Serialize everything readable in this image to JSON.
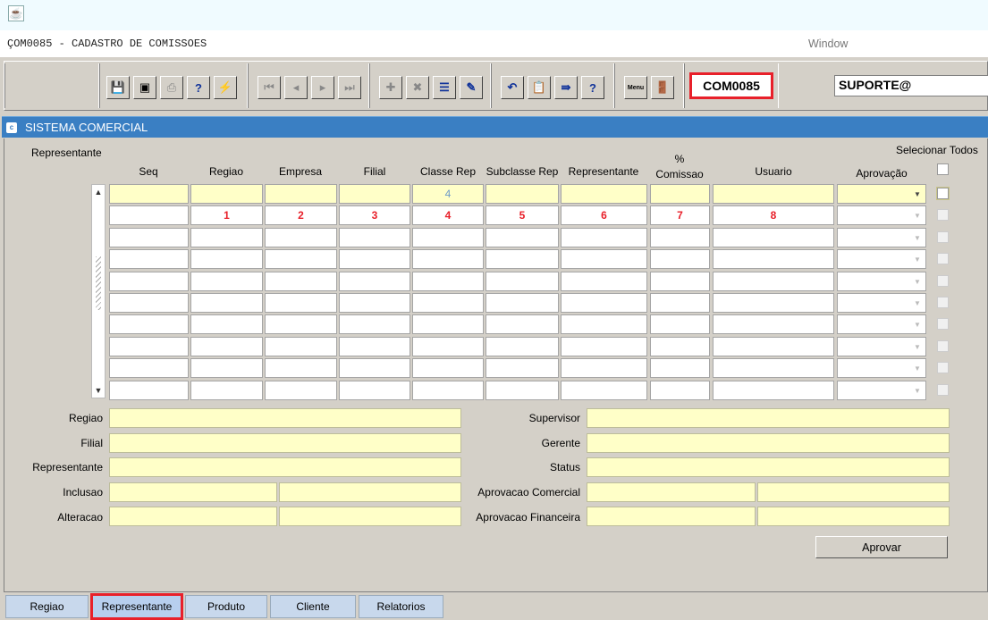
{
  "window": {
    "app_icon": "java-cup-icon",
    "title": "ÇOM0085 - CADASTRO DE COMISSOES",
    "menu_window": "Window"
  },
  "toolbar": {
    "icons": {
      "save": "save-icon",
      "print_screen": "screen-icon",
      "print": "printer-icon",
      "query": "query-icon",
      "execute_query": "execute-query-icon",
      "first": "first-record-icon",
      "prev": "prev-record-icon",
      "next": "next-record-icon",
      "last": "last-record-icon",
      "insert": "insert-record-icon",
      "delete": "delete-record-icon",
      "list": "list-values-icon",
      "edit": "edit-icon",
      "undo": "undo-icon",
      "clipboard": "clipboard-icon",
      "exit_form": "exit-form-icon",
      "help": "help-icon",
      "menu": "menu-icon",
      "exit": "exit-door-icon"
    },
    "help_glyph": "?",
    "menu_glyph": "Menu",
    "form_code": "COM0085",
    "user": "SUPORTE@"
  },
  "panel": {
    "title": "SISTEMA COMERCIAL"
  },
  "grid": {
    "section_label": "Representante",
    "select_all_label": "Selecionar Todos",
    "columns": {
      "seq": "Seq",
      "regiao": "Regiao",
      "empresa": "Empresa",
      "filial": "Filial",
      "classe_rep": "Classe Rep",
      "subclasse_rep": "Subclasse Rep",
      "representante": "Representante",
      "pct": "%",
      "comissao": "Comissao",
      "usuario": "Usuario",
      "aprovacao": "Aprovação"
    },
    "row1_classe_rep": "4",
    "row2_markers": {
      "regiao": "1",
      "empresa": "2",
      "filial": "3",
      "classe_rep": "4",
      "subclasse_rep": "5",
      "representante": "6",
      "comissao": "7",
      "usuario": "8"
    }
  },
  "detail": {
    "regiao": "Regiao",
    "filial": "Filial",
    "representante": "Representante",
    "inclusao": "Inclusao",
    "alteracao": "Alteracao",
    "supervisor": "Supervisor",
    "gerente": "Gerente",
    "status": "Status",
    "aprovacao_comercial": "Aprovacao Comercial",
    "aprovacao_financeira": "Aprovacao Financeira"
  },
  "approve_button": "Aprovar",
  "tabs": [
    {
      "label": "Regiao"
    },
    {
      "label": "Representante",
      "active": true
    },
    {
      "label": "Produto"
    },
    {
      "label": "Cliente"
    },
    {
      "label": "Relatorios"
    }
  ],
  "colors": {
    "highlight": "#e8202a",
    "header": "#3a7fc3",
    "field_yellow": "#ffffc8"
  }
}
